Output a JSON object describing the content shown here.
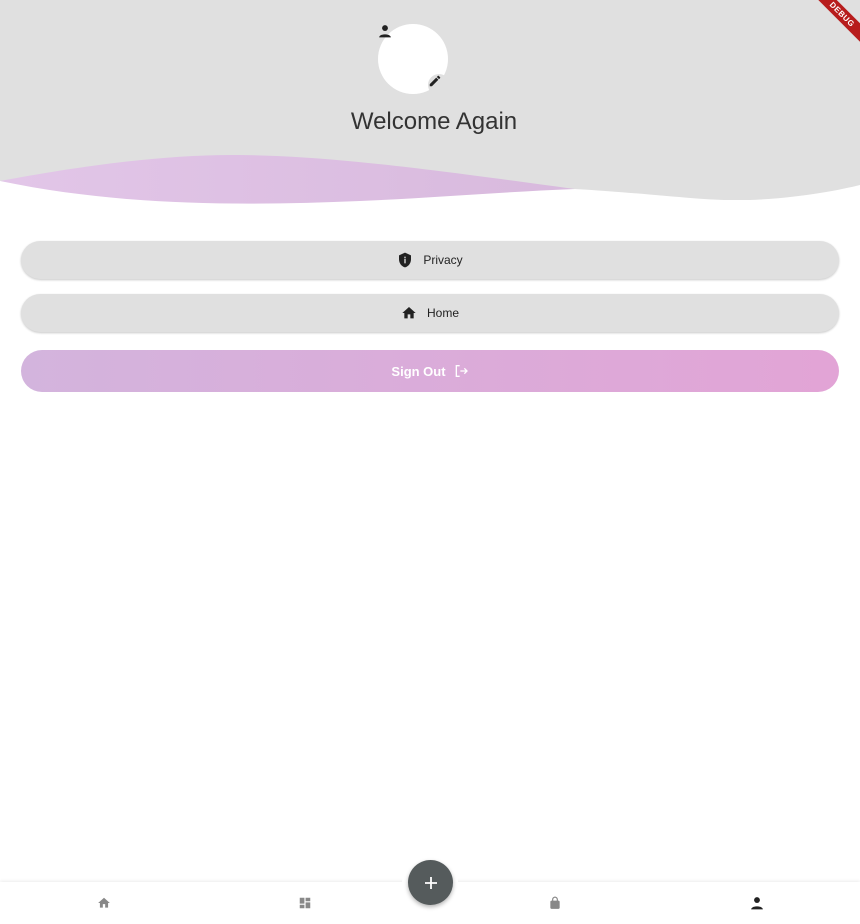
{
  "header": {
    "title": "Welcome Again",
    "debug_label": "DEBUG",
    "colors": {
      "background": "#e0e0e0",
      "wave": "#dcc2e4"
    }
  },
  "avatar": {
    "icon": "person-icon",
    "edit_icon": "pencil-icon"
  },
  "menu": [
    {
      "label": "Privacy",
      "icon": "shield-icon"
    },
    {
      "label": "Home",
      "icon": "home-icon"
    }
  ],
  "signout": {
    "label": "Sign Out",
    "icon": "logout-icon",
    "colors": {
      "start": "#d3b4dd",
      "end": "#e2a4d6"
    }
  },
  "bottom_nav": {
    "items": [
      {
        "icon": "home-icon"
      },
      {
        "icon": "dashboard-icon"
      },
      {
        "icon": "lock-icon"
      },
      {
        "icon": "person-icon"
      }
    ],
    "fab_icon": "plus-icon",
    "active_index": 3
  }
}
